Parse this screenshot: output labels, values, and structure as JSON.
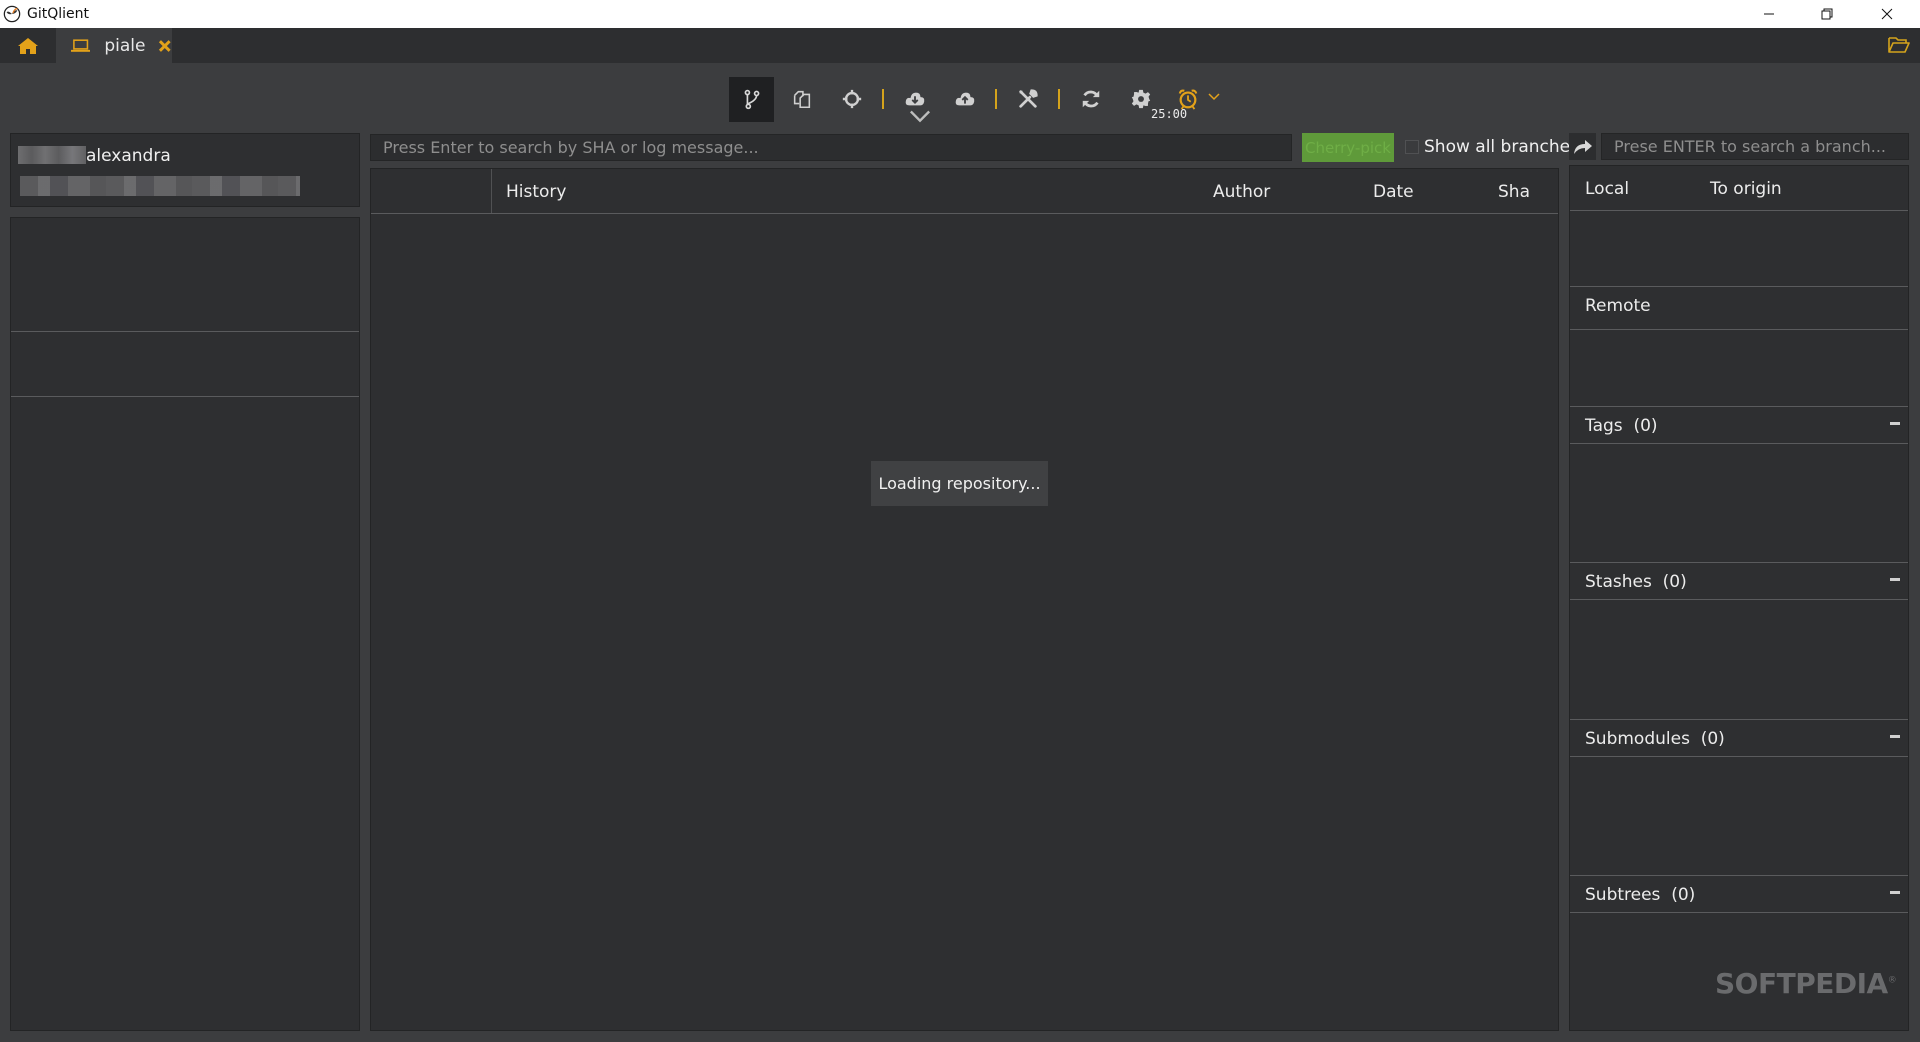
{
  "window": {
    "title": "GitQlient",
    "controls": {
      "minimize": "minimize-icon",
      "maximize": "restore-icon",
      "close": "close-icon"
    }
  },
  "tabs": {
    "home_icon": "home-icon",
    "items": [
      {
        "label": "piale",
        "icon": "laptop-icon",
        "close_icon": "close-icon"
      }
    ],
    "open_repo_icon": "folder-open-icon"
  },
  "toolbar": {
    "buttons": [
      {
        "name": "branches",
        "icon": "git-branch-icon",
        "active": true
      },
      {
        "name": "diff",
        "icon": "copy-files-icon"
      },
      {
        "name": "go-to-head",
        "icon": "crosshair-icon"
      },
      {
        "name": "pull",
        "icon": "cloud-download-icon",
        "has_menu": true
      },
      {
        "name": "push",
        "icon": "cloud-upload-icon"
      },
      {
        "name": "git-tools",
        "icon": "tools-icon"
      },
      {
        "name": "refresh",
        "icon": "refresh-icon"
      },
      {
        "name": "config",
        "icon": "gear-icon"
      },
      {
        "name": "pomodoro",
        "icon": "alarm-clock-icon",
        "has_menu": true
      }
    ],
    "timer": "25:00",
    "accent_color": "#d4a31c"
  },
  "user": {
    "name_visible": "alexandra",
    "email_obscured": true
  },
  "history": {
    "search_placeholder": "Press Enter to search by SHA or log message...",
    "cherry_pick_label": "Cherry-pick",
    "show_all_branches_label": "Show all branches",
    "show_all_branches_checked": false,
    "columns": [
      "",
      "History",
      "Author",
      "Date",
      "Sha"
    ],
    "loading_text": "Loading repository..."
  },
  "branches": {
    "search_placeholder": "Prese ENTER to search a branch...",
    "local_header": "Local",
    "to_origin_header": "To origin",
    "remote_header": "Remote",
    "sections": [
      {
        "label": "Tags",
        "count": "(0)"
      },
      {
        "label": "Stashes",
        "count": "(0)"
      },
      {
        "label": "Submodules",
        "count": "(0)"
      },
      {
        "label": "Subtrees",
        "count": "(0)"
      }
    ]
  },
  "watermark": {
    "text": "SOFTPEDIA",
    "mark": "®"
  },
  "colors": {
    "background": "#3c3d3f",
    "panel": "#2e2f31",
    "accent": "#d4a31c",
    "cherry_pick_bg": "#5f9a3a"
  }
}
